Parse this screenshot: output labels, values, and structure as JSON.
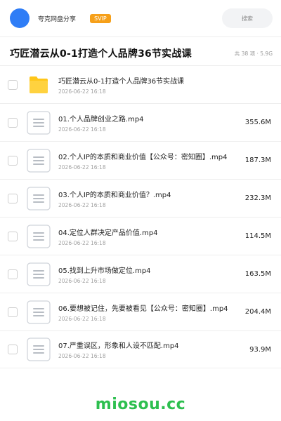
{
  "header": {
    "brand": "夸克网盘分享",
    "badge": "SVIP",
    "search_label": "搜索"
  },
  "share": {
    "title": "巧匠潜云从0-1打造个人品牌36节实战课",
    "summary": "共 38 项 · 5.9G"
  },
  "items": [
    {
      "type": "folder",
      "name": "巧匠潜云从0-1打造个人品牌36节实战课",
      "date": "2026-06-22 16:18",
      "size": ""
    },
    {
      "type": "file",
      "name": "01.个人品牌创业之路.mp4",
      "date": "2026-06-22 16:18",
      "size": "355.6M"
    },
    {
      "type": "file",
      "name": "02.个人IP的本质和商业价值【公众号：密知圈】.mp4",
      "date": "2026-06-22 16:18",
      "size": "187.3M"
    },
    {
      "type": "file",
      "name": "03.个人IP的本质和商业价值？.mp4",
      "date": "2026-06-22 16:18",
      "size": "232.3M"
    },
    {
      "type": "file",
      "name": "04.定位人群决定产品价值.mp4",
      "date": "2026-06-22 16:18",
      "size": "114.5M"
    },
    {
      "type": "file",
      "name": "05.找到上升市场做定位.mp4",
      "date": "2026-06-22 16:18",
      "size": "163.5M"
    },
    {
      "type": "file",
      "name": "06.要想被记住，先要被看见【公众号：密知圈】.mp4",
      "date": "2026-06-22 16:18",
      "size": "204.4M"
    },
    {
      "type": "file",
      "name": "07.严重误区，形象和人设不匹配.mp4",
      "date": "2026-06-22 16:18",
      "size": "93.9M"
    }
  ],
  "watermark": "miosou.cc",
  "colors": {
    "accent": "#2f7df6",
    "svip": "#f6a01a",
    "folder": "#ffc61a",
    "watermark": "#2dbf4f"
  }
}
